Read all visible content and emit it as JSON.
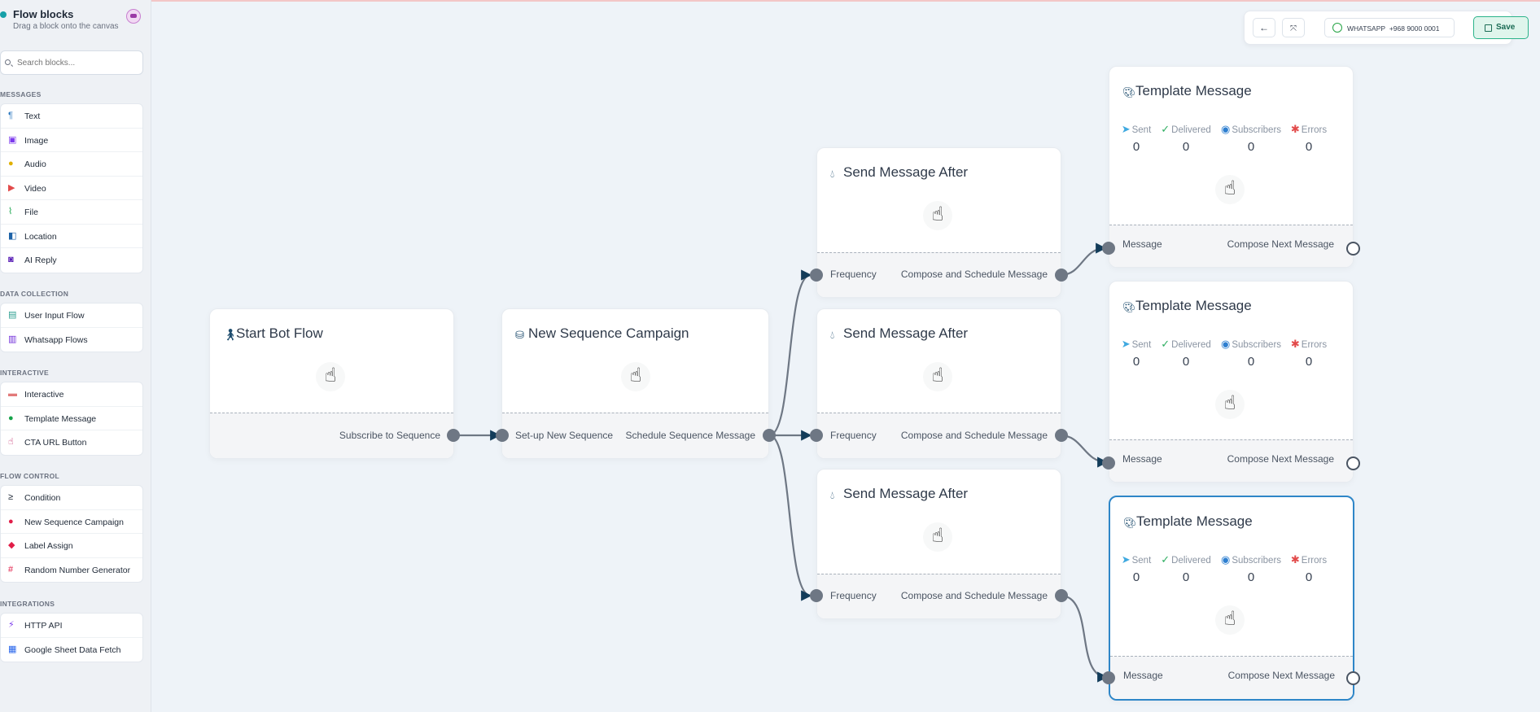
{
  "sidebar": {
    "title": "Flow blocks",
    "subtitle": "Drag a block onto the canvas",
    "search_placeholder": "Search blocks...",
    "sections": [
      {
        "label": "MESSAGES",
        "items": [
          {
            "label": "Text",
            "icon": "paragraph-icon",
            "color": "#3b82c4"
          },
          {
            "label": "Image",
            "icon": "image-icon",
            "color": "#7c3aed"
          },
          {
            "label": "Audio",
            "icon": "microphone-icon",
            "color": "#e0b000"
          },
          {
            "label": "Video",
            "icon": "video-icon",
            "color": "#e24a4a"
          },
          {
            "label": "File",
            "icon": "paperclip-icon",
            "color": "#16a34a"
          },
          {
            "label": "Location",
            "icon": "map-icon",
            "color": "#1e63a8"
          },
          {
            "label": "AI Reply",
            "icon": "robot-icon",
            "color": "#5b21b6"
          }
        ]
      },
      {
        "label": "DATA COLLECTION",
        "items": [
          {
            "label": "User Input Flow",
            "icon": "keyboard-icon",
            "color": "#2a9d8f"
          },
          {
            "label": "Whatsapp Flows",
            "icon": "list-icon",
            "color": "#6d28d9"
          }
        ]
      },
      {
        "label": "INTERACTIVE",
        "items": [
          {
            "label": "Interactive",
            "icon": "window-icon",
            "color": "#e27a7a"
          },
          {
            "label": "Template Message",
            "icon": "palette-icon",
            "color": "#16a34a"
          },
          {
            "label": "CTA URL Button",
            "icon": "hand-pointer-icon",
            "color": "#be185d"
          }
        ]
      },
      {
        "label": "FLOW CONTROL",
        "items": [
          {
            "label": "Condition",
            "icon": "greater-equal-icon",
            "color": "#1f2937"
          },
          {
            "label": "New Sequence Campaign",
            "icon": "drop-icon",
            "color": "#e11d48"
          },
          {
            "label": "Label Assign",
            "icon": "tags-icon",
            "color": "#e11d48"
          },
          {
            "label": "Random Number Generator",
            "icon": "hashtag-icon",
            "color": "#e11d48"
          }
        ]
      },
      {
        "label": "INTEGRATIONS",
        "items": [
          {
            "label": "HTTP API",
            "icon": "plug-icon",
            "color": "#7c3aed"
          },
          {
            "label": "Google Sheet Data Fetch",
            "icon": "sheet-icon",
            "color": "#2563eb"
          }
        ]
      }
    ]
  },
  "toolbar": {
    "back_icon": "arrow-left-icon",
    "fit_icon": "expand-icon",
    "whatsapp_label": "WHATSAPP",
    "whatsapp_number": "+968 9000 0001",
    "save_label": "Save",
    "save_color": "#2bb38a"
  },
  "nodes": {
    "start": {
      "title": "Start Bot Flow",
      "out": "Subscribe to Sequence"
    },
    "campaign": {
      "title": "New Sequence Campaign",
      "in": "Set-up New Sequence",
      "out": "Schedule Sequence Message"
    },
    "send": {
      "title": "Send Message After",
      "in": "Frequency",
      "out": "Compose and Schedule Message"
    },
    "template": {
      "title": "Template Message",
      "stats": [
        {
          "label": "Sent",
          "value": "0",
          "color": "#3fa9e0"
        },
        {
          "label": "Delivered",
          "value": "0",
          "color": "#2fae62"
        },
        {
          "label": "Subscribers",
          "value": "0",
          "color": "#2e7fd0"
        },
        {
          "label": "Errors",
          "value": "0",
          "color": "#e24a4a"
        }
      ],
      "in": "Message",
      "out": "Compose Next Message"
    }
  },
  "colors": {
    "wire": "#123c5a",
    "selected": "#2e86c8",
    "port": "#6e7784"
  }
}
